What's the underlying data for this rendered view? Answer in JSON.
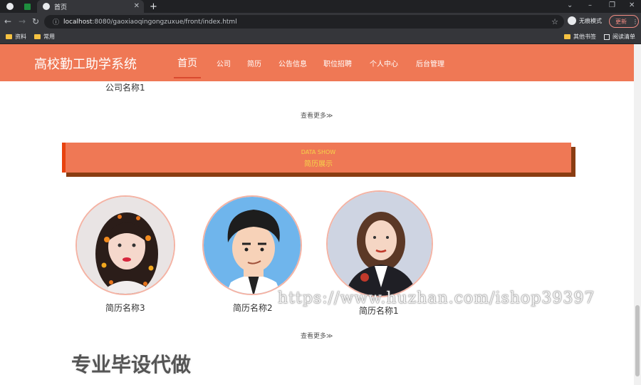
{
  "browser": {
    "tab_title": "首页",
    "url_host": "localhost",
    "url_rest": ":8080/gaoxiaoqingongzuxue/front/index.html",
    "incognito_label": "无痕模式",
    "update_label": "更新",
    "bookmarks": [
      "资料",
      "常用"
    ],
    "other_bookmarks": "其他书签",
    "reading_list": "阅读清单"
  },
  "site": {
    "logo": "高校勤工助学系统",
    "nav": [
      "首页",
      "公司",
      "简历",
      "公告信息",
      "职位招聘",
      "个人中心",
      "后台管理"
    ]
  },
  "company_section": {
    "item_name": "公司名称1",
    "see_more": "查看更多≫"
  },
  "banner": {
    "en": "DATA SHOW",
    "cn": "简历展示"
  },
  "resume_section": {
    "items": [
      {
        "label": "简历名称3"
      },
      {
        "label": "简历名称2"
      },
      {
        "label": "简历名称1"
      }
    ],
    "see_more": "查看更多≫"
  },
  "overlay": {
    "watermark": "https://www.huzhan.com/ishop39397",
    "promo": "专业毕设代做"
  },
  "colors": {
    "accent": "#ef7855",
    "banner_shadow": "#8a3d12",
    "banner_text": "#f5d44a"
  }
}
